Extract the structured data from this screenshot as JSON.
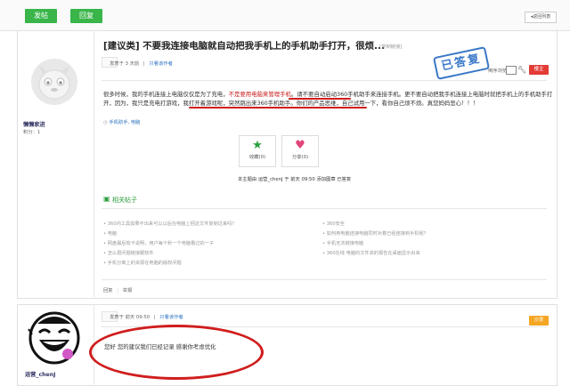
{
  "toolbar": {
    "post_label": "发帖",
    "reply_label": "回复",
    "back_label": "返回列表"
  },
  "post": {
    "title": "[建议类] 不要我连接电脑就自动把我手机上的手机助手打开，很烦...",
    "copy_link": "[复制链接]",
    "meta_time": "发表于 3 天前",
    "meta_sep": "|",
    "meta_author_only": "只看该作者",
    "stamp": "已答复",
    "sort_label": "倒序浏览",
    "sort_checkbox": "",
    "floor": "楼主",
    "body_part1": "很多时候，我的手机连接上电脑仅仅是为了充电，",
    "body_part2": "不是要用电脑来管理手机",
    "body_part3": "。请不要自动启动360手机助手来连接手机。更不要自动把我手机连接上电脑时就把手机上的手机助手打开，因为，",
    "body_part4": "我只是充电打游戏",
    "body_part5": "，",
    "body_part6": "我打开着游戏呢",
    "body_part7": "，",
    "body_part8": "突然跳出来360手机助手",
    "body_part9": "。你们的产品思维，自己试用一下，看你自己烦不烦。真您妈妈恶心！！！",
    "tags": "手机助手, 电脑",
    "fav_label": "收藏(0)",
    "share_label": "分享(0)",
    "edit_note": "本主题由 运营_chenJ 于 前天 09:50 添加图章 已答复",
    "related_title": "相关帖子",
    "related_left": [
      "360内工具如果不出来可以以后在电脑上把这文件复制过来吗？",
      "电脑",
      "网盘最后软卡说明，用户每个秒一个电脑看过的一子",
      "怎么把问题链接跟软件",
      "手机分离上的资源在电脑的版权问题"
    ],
    "related_right": [
      "360安全",
      "如何用电脑连接电脑同时对着已经连接到手机呢？",
      "手机无法链接电脑",
      "360在线 电脑的文件夹的报告在桌面显示出来"
    ],
    "reply_label": "回复",
    "report_label": "举报"
  },
  "user1": {
    "name": "懒懒家进",
    "score": "积分：1"
  },
  "reply": {
    "meta_time": "发表于 前天 09:50",
    "meta_sep": "|",
    "meta_author_only": "只看该作者",
    "floor": "沙发",
    "text": "您好  您的建议我们已经记录  感谢你考虑优化"
  },
  "user2": {
    "name": "运营_chenJ"
  },
  "colors": {
    "green": "#39b54a",
    "red_annotation": "#d01d1d",
    "stamp_blue": "#3a78c8",
    "floor_red": "#e33c36",
    "floor_orange": "#f5a623"
  }
}
